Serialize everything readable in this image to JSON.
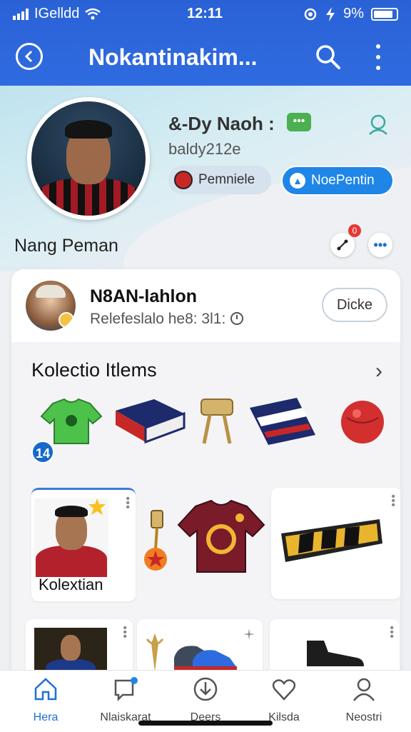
{
  "status": {
    "carrier": "IGelldd",
    "time": "12:11",
    "battery": "9%"
  },
  "appbar": {
    "title": "Nokantinakim..."
  },
  "profile": {
    "name": "&-Dy Naoh :",
    "handle": "baldy212e",
    "chip_primary": "Pemniele",
    "chip_secondary": "NoePentin",
    "subname": "Nang Peman",
    "notif_count": "0"
  },
  "card": {
    "user_name": "N8AN-lahlon",
    "user_sub": "Relefeslalo he8: 3l1:",
    "action_button": "Dicke",
    "section_title": "Kolectio Itlems",
    "items_count_badge": "14",
    "tiles": [
      {
        "label": "Kolextian"
      }
    ]
  },
  "nav": [
    {
      "label": "Hera",
      "icon": "home-icon",
      "active": true
    },
    {
      "label": "Nlaiskarat",
      "icon": "chat-icon",
      "active": false
    },
    {
      "label": "Deers",
      "icon": "download-icon",
      "active": false
    },
    {
      "label": "Kilsda",
      "icon": "heart-icon",
      "active": false
    },
    {
      "label": "Neostri",
      "icon": "person-icon",
      "active": false
    }
  ],
  "colors": {
    "primary": "#2f6be0",
    "accent_blue": "#1f86e8",
    "active_nav": "#1f6fd6"
  }
}
